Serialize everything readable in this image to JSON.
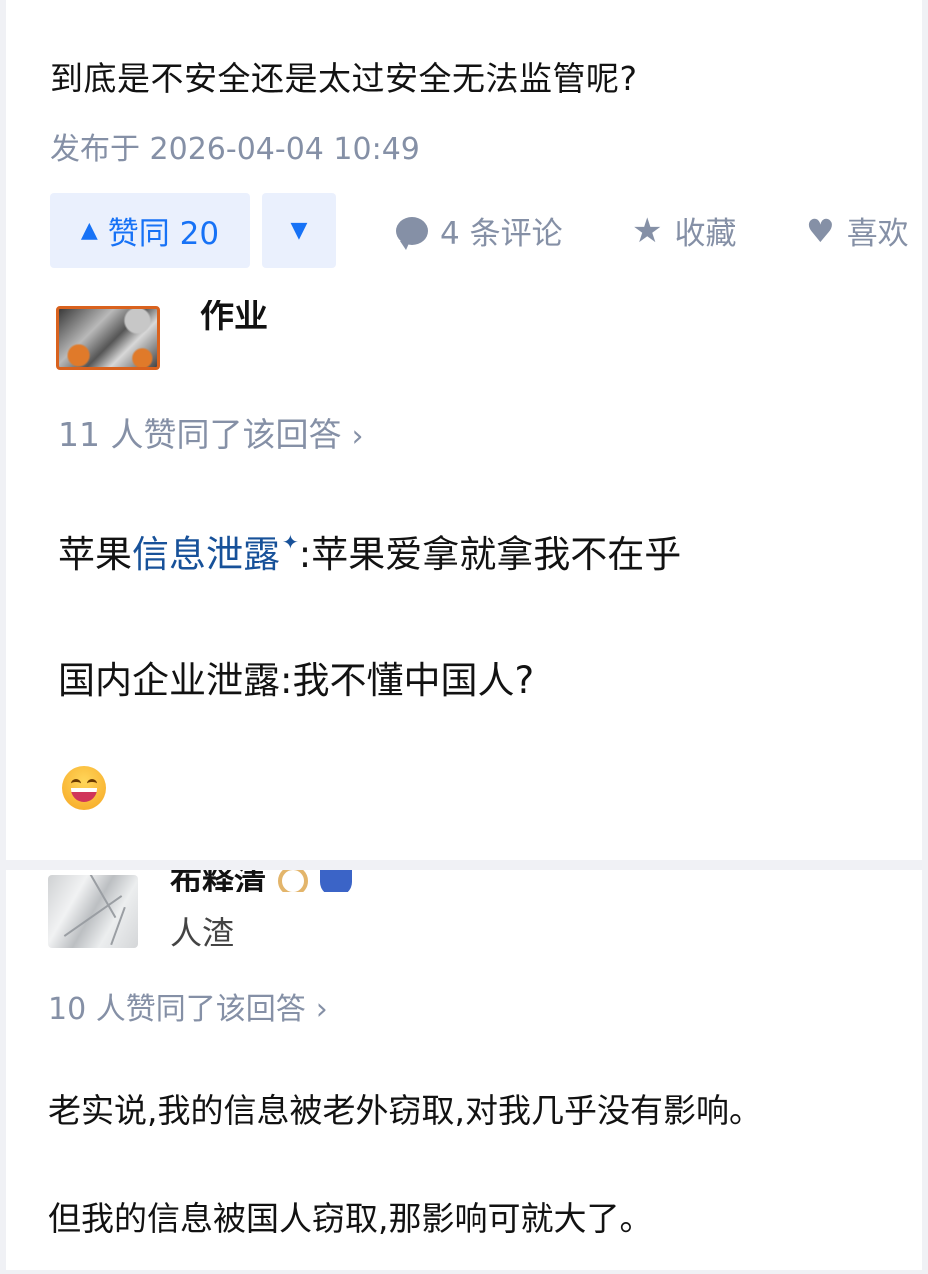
{
  "previous_answer": {
    "tail_text": "到底是不安全还是太过安全无法监管呢?",
    "published": "发布于 2026-04-04 10:49",
    "actions": {
      "upvote_label": "赞同 20",
      "comments_label": "4 条评论",
      "collect_label": "收藏",
      "like_label": "喜欢"
    }
  },
  "answers": [
    {
      "author_name": "作业",
      "agree_text": "11 人赞同了该回答",
      "content": {
        "line1_prefix": "苹果",
        "line1_link": "信息泄露",
        "line1_suffix": ":苹果爱拿就拿我不在乎",
        "line2": "国内企业泄露:我不懂中国人?"
      }
    },
    {
      "author_name": "布释清",
      "author_headline": "人渣",
      "agree_text": "10 人赞同了该回答",
      "content": {
        "line1": "老实说,我的信息被老外窃取,对我几乎没有影响。",
        "line2": "但我的信息被国人窃取,那影响可就大了。"
      }
    }
  ],
  "colors": {
    "accent_blue": "#1772f6",
    "link_blue": "#175199",
    "meta_gray": "#8590a6"
  },
  "icons": [
    "triangle-up-icon",
    "triangle-down-icon",
    "comment-bubble-icon",
    "star-icon",
    "heart-icon",
    "sparkle-icon",
    "grin-emoji-icon",
    "chevron-right-icon"
  ]
}
